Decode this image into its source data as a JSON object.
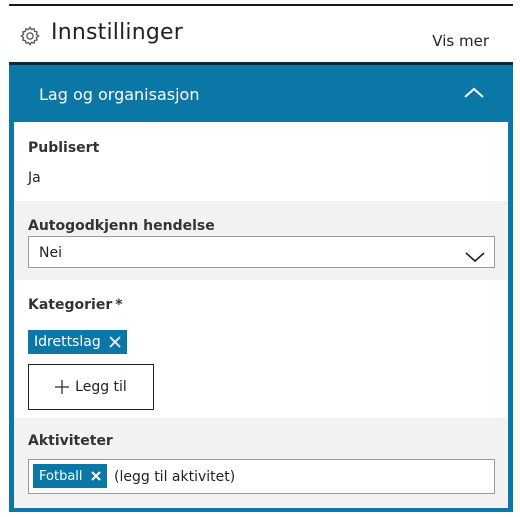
{
  "header": {
    "title": "Innstillinger",
    "icon": "gear-icon",
    "more_label": "Vis mer"
  },
  "accordion": {
    "title": "Lag og organisasjon",
    "expanded": true
  },
  "publisert": {
    "label": "Publisert",
    "value": "Ja"
  },
  "autogodkjenn": {
    "label": "Autogodkjenn hendelse",
    "selected": "Nei"
  },
  "kategorier": {
    "label": "Kategorier",
    "required_mark": "*",
    "tags": [
      "Idrettslag"
    ],
    "add_label": "Legg til"
  },
  "aktiviteter": {
    "label": "Aktiviteter",
    "tags": [
      "Fotball"
    ],
    "placeholder": "(legg til aktivitet)"
  },
  "colors": {
    "accent": "#0b77a6",
    "header_rule": "#0b2c3d",
    "section_alt_bg": "#f2f2f2"
  }
}
